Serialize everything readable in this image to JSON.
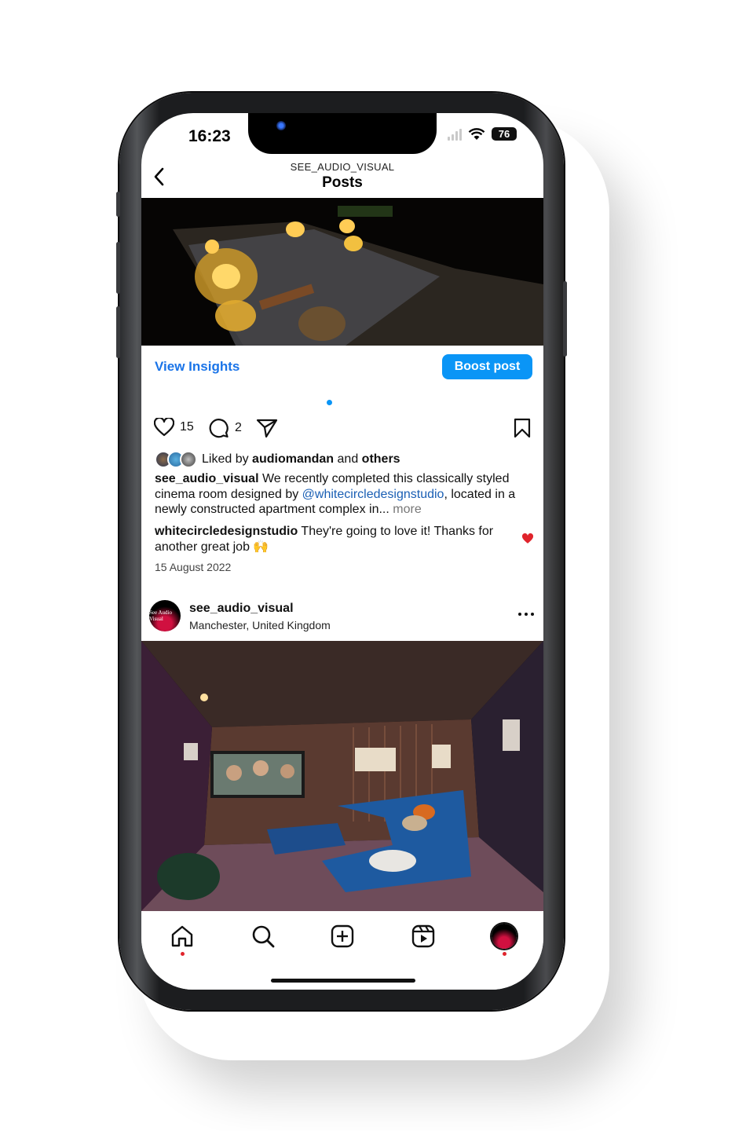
{
  "status_bar": {
    "time": "16:23",
    "battery": "76"
  },
  "header": {
    "subtitle": "SEE_AUDIO_VISUAL",
    "title": "Posts"
  },
  "post1": {
    "view_insights": "View Insights",
    "boost_post": "Boost post",
    "likes_count": "15",
    "comments_count": "2",
    "liked_by_prefix": "Liked by",
    "liked_by_user": "audiomandan",
    "liked_by_and": "and",
    "liked_by_others": "others",
    "caption_user": "see_audio_visual",
    "caption_text_1": "We recently completed this classically styled cinema room designed by",
    "caption_mention": "@whitecircledesignstudio",
    "caption_text_2": ", located in a newly constructed apartment complex in...",
    "caption_more": "more",
    "comment_user": "whitecircledesignstudio",
    "comment_text": "They're going to love it! Thanks for another great job 🙌",
    "date": "15 August 2022"
  },
  "post2": {
    "username": "see_audio_visual",
    "location": "Manchester, United Kingdom",
    "avatar_text": "See Audio Visual"
  },
  "tabbar": {
    "items": [
      "home",
      "search",
      "create",
      "reels",
      "profile"
    ]
  },
  "colors": {
    "accent": "#0a95f6",
    "mention": "#1a5fb4",
    "heart": "#e0242c"
  }
}
